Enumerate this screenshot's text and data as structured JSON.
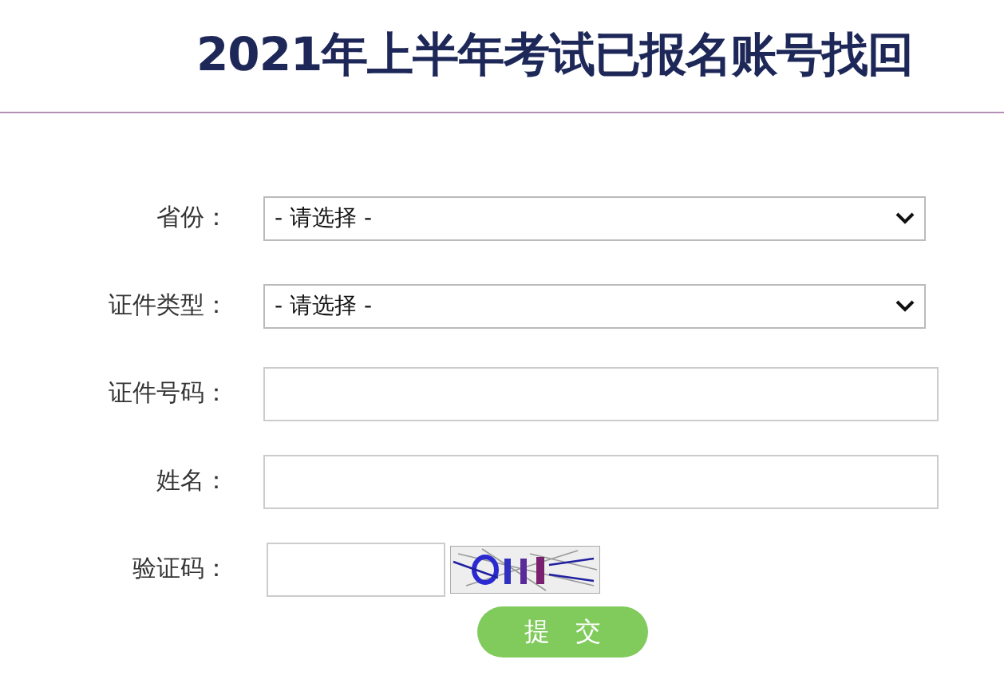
{
  "title": "2021年上半年考试已报名账号找回",
  "fields": [
    {
      "kind": "select",
      "label": "省份：",
      "value": "- 请选择 -"
    },
    {
      "kind": "select",
      "label": "证件类型：",
      "value": "- 请选择 -"
    },
    {
      "kind": "text",
      "label": "证件号码："
    },
    {
      "kind": "text",
      "label": "姓名："
    },
    {
      "kind": "captcha",
      "label": "验证码："
    }
  ],
  "submit": "提　交"
}
